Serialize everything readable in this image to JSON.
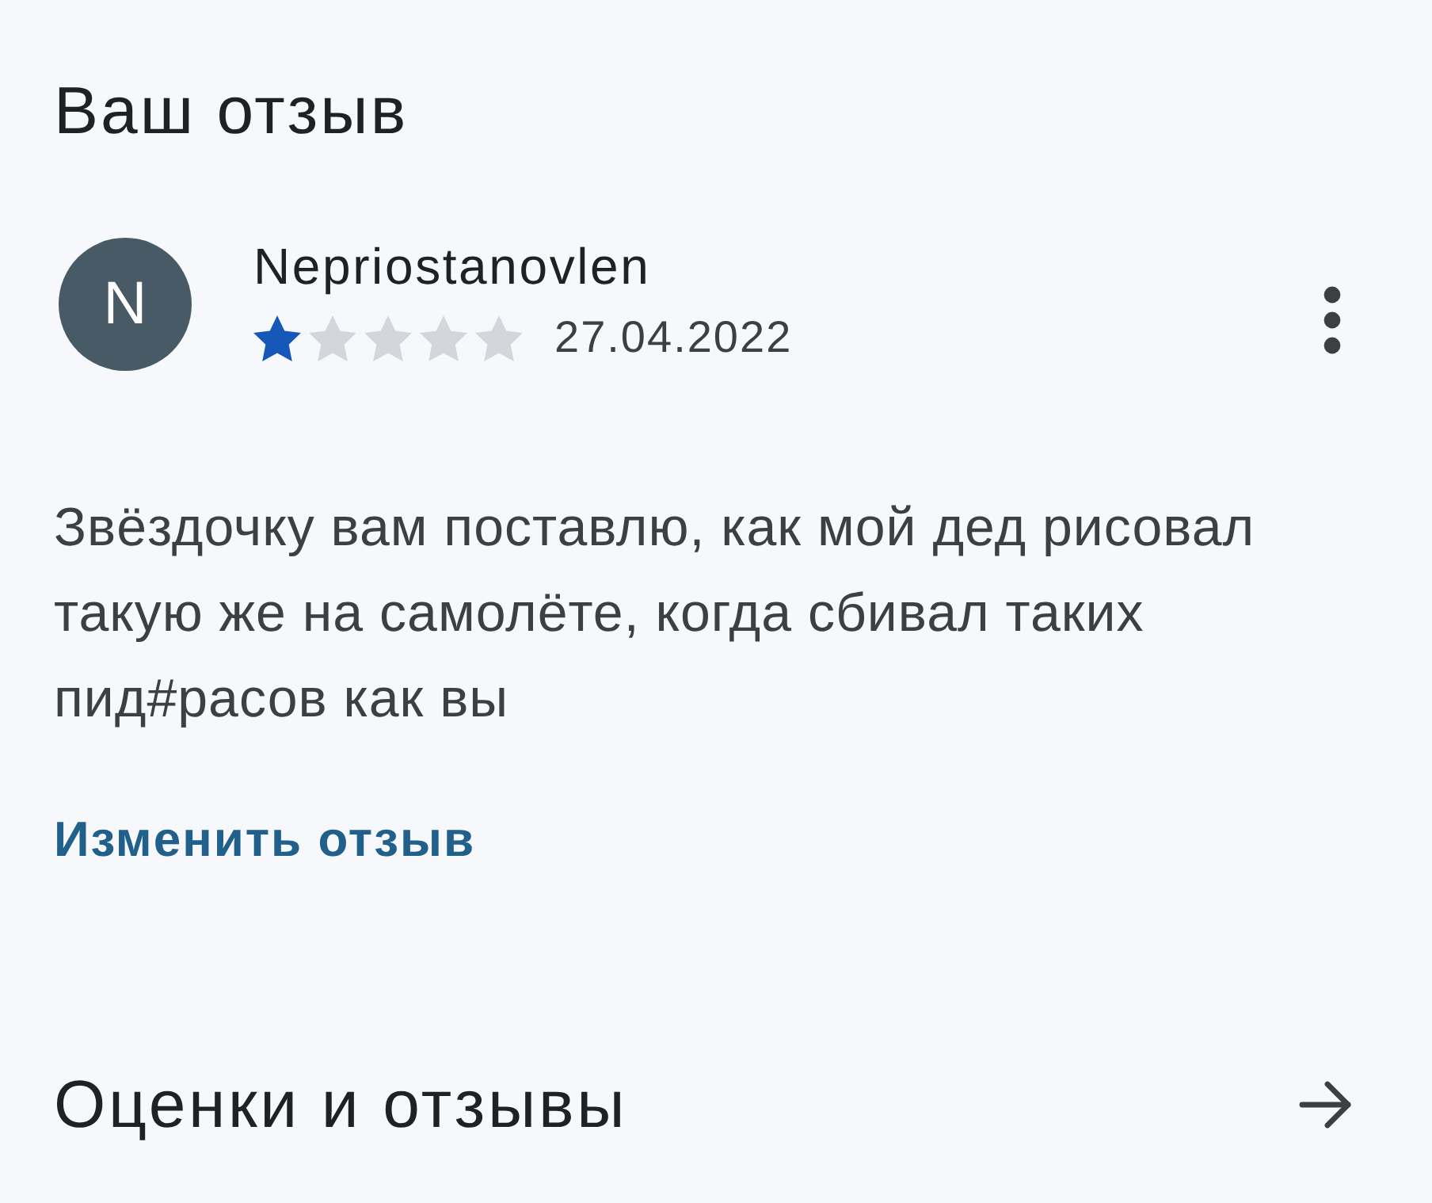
{
  "section_title": "Ваш отзыв",
  "review": {
    "avatar_letter": "N",
    "author": "Nepriostanovlen",
    "stars": 1,
    "date": "27.04.2022",
    "text": "Звёздочку вам поставлю, как мой дед рисовал такую же на самолёте, когда сбивал таких пид#расов как вы",
    "edit_link": "Изменить отзыв"
  },
  "ratings_section": {
    "title": "Оценки и отзывы"
  }
}
